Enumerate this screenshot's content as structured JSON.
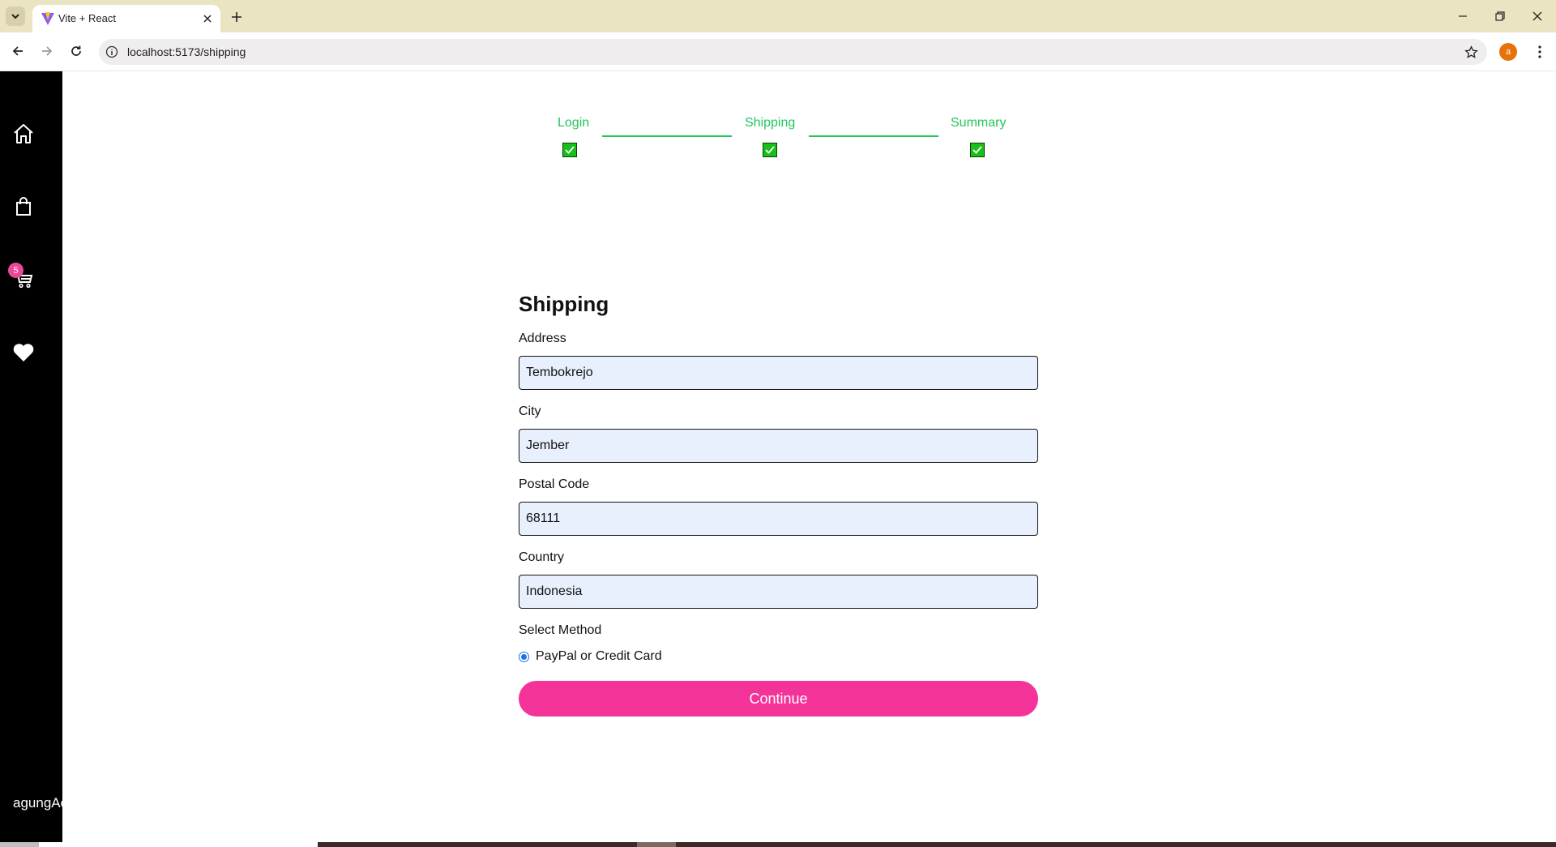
{
  "browser": {
    "tab_title": "Vite + React",
    "url": "localhost:5173/shipping",
    "profile_initial": "a"
  },
  "sidebar": {
    "items": [
      {
        "name": "home",
        "icon": "home-icon"
      },
      {
        "name": "shop",
        "icon": "shopping-bag-icon"
      },
      {
        "name": "cart",
        "icon": "cart-icon"
      },
      {
        "name": "favorites",
        "icon": "heart-icon"
      }
    ],
    "cart_count": "5",
    "username": "agungAc"
  },
  "progress": {
    "color": "#22c55e",
    "steps": [
      {
        "label": "Login",
        "done": true
      },
      {
        "label": "Shipping",
        "done": true
      },
      {
        "label": "Summary",
        "done": true
      }
    ]
  },
  "form": {
    "title": "Shipping",
    "address_label": "Address",
    "address_value": "Tembokrejo",
    "city_label": "City",
    "city_value": "Jember",
    "postal_label": "Postal Code",
    "postal_value": "68111",
    "country_label": "Country",
    "country_value": "Indonesia",
    "method_label": "Select Method",
    "method_option": "PayPal or Credit Card",
    "continue_label": "Continue",
    "button_color": "#f43399"
  }
}
